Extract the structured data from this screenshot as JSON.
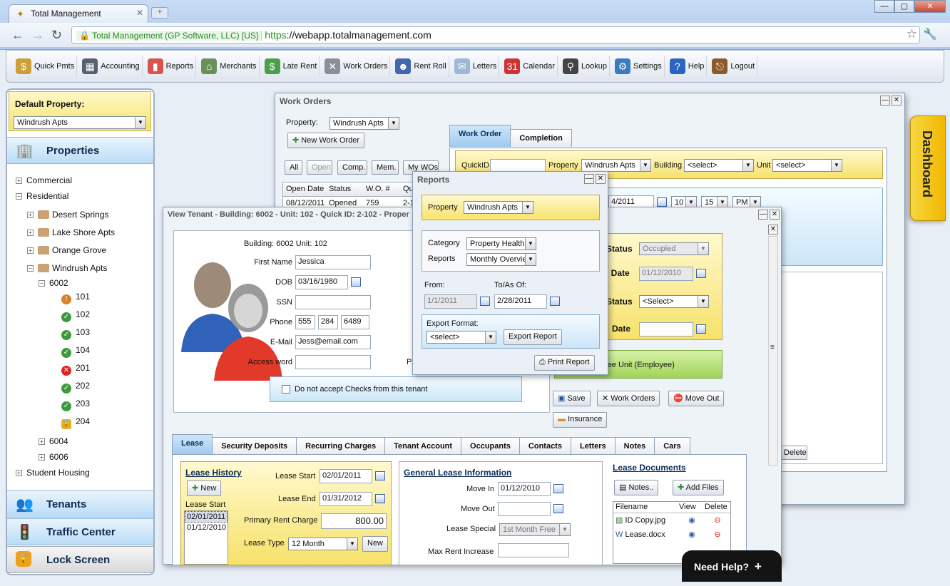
{
  "browser": {
    "tab_title": "Total Management",
    "tab_close": "✕",
    "new_tab": "+",
    "window_buttons": [
      "—",
      "▢",
      "✕"
    ],
    "nav_back": "←",
    "nav_forward": "→",
    "nav_reload": "↻",
    "cert_label": "Total Management (GP Software, LLC) [US]",
    "url_scheme": "https",
    "url_rest": "://webapp.totalmanagement.com",
    "star": "☆",
    "wrench": "🔧"
  },
  "toolbar": [
    {
      "label": "Quick Pmts",
      "icon": "quick-payments-icon",
      "color": "#c9a03a",
      "glyph": "$"
    },
    {
      "label": "Accounting",
      "icon": "accounting-icon",
      "color": "#556070",
      "glyph": "▦"
    },
    {
      "label": "Reports",
      "icon": "reports-icon",
      "color": "#d9534f",
      "glyph": "▮"
    },
    {
      "label": "Merchants",
      "icon": "merchants-icon",
      "color": "#6a8f5a",
      "glyph": "⌂"
    },
    {
      "label": "Late Rent",
      "icon": "late-rent-icon",
      "color": "#4aa04a",
      "glyph": "$"
    },
    {
      "label": "Work Orders",
      "icon": "work-orders-icon",
      "color": "#8a8f98",
      "glyph": "✕"
    },
    {
      "label": "Rent Roll",
      "icon": "rent-roll-icon",
      "color": "#4466aa",
      "glyph": "☻"
    },
    {
      "label": "Letters",
      "icon": "letters-icon",
      "color": "#9cb8d6",
      "glyph": "✉"
    },
    {
      "label": "Calendar",
      "icon": "calendar-icon",
      "color": "#c33",
      "glyph": "31"
    },
    {
      "label": "Lookup",
      "icon": "lookup-icon",
      "color": "#444",
      "glyph": "⚲"
    },
    {
      "label": "Settings",
      "icon": "settings-icon",
      "color": "#3a7bbf",
      "glyph": "⚙"
    },
    {
      "label": "Help",
      "icon": "help-icon",
      "color": "#2a65c2",
      "glyph": "?"
    },
    {
      "label": "Logout",
      "icon": "logout-icon",
      "color": "#8a5a2a",
      "glyph": "⎋"
    }
  ],
  "sidebar": {
    "default_property_label": "Default Property:",
    "default_property_value": "Windrush Apts",
    "properties_label": "Properties",
    "tree": {
      "commercial": "Commercial",
      "residential": "Residential",
      "desert_springs": "Desert Springs",
      "lake_shore": "Lake Shore Apts",
      "orange_grove": "Orange Grove",
      "windrush": "Windrush Apts",
      "b6002": "6002",
      "b6004": "6004",
      "b6006": "6006",
      "student_housing": "Student Housing"
    },
    "units": [
      {
        "label": "101",
        "status": "warn",
        "glyph": "!"
      },
      {
        "label": "102",
        "status": "ok",
        "glyph": "✓"
      },
      {
        "label": "103",
        "status": "ok",
        "glyph": "✓"
      },
      {
        "label": "104",
        "status": "ok",
        "glyph": "✓"
      },
      {
        "label": "201",
        "status": "vacant",
        "glyph": "✕"
      },
      {
        "label": "202",
        "status": "ok",
        "glyph": "✓"
      },
      {
        "label": "203",
        "status": "ok",
        "glyph": "✓"
      },
      {
        "label": "204",
        "status": "locked",
        "glyph": "🔒"
      }
    ],
    "plus": "+",
    "minus": "−",
    "tenants_label": "Tenants",
    "traffic_label": "Traffic Center",
    "lock_label": "Lock Screen"
  },
  "work_orders": {
    "title": "Work Orders",
    "property_label": "Property:",
    "property_value": "Windrush Apts",
    "new_button": "New Work Order",
    "filters": [
      "All",
      "Open",
      "Comp.",
      "Mem.",
      "My WOs"
    ],
    "columns": [
      "Open Date",
      "Status",
      "W.O. #",
      "Qui"
    ],
    "row": [
      "08/12/2011",
      "Opened",
      "759",
      "2-10"
    ],
    "tabs": [
      "Work Order",
      "Completion"
    ],
    "quickid_label": "QuickID",
    "prop_label": "Property",
    "prop_value": "Windrush Apts",
    "building_label": "Building",
    "building_value": "<select>",
    "unit_label": "Unit",
    "unit_value": "<select>",
    "date_value": "4/2011",
    "hour": "10",
    "minute": "15",
    "ampm": "PM",
    "delete_button": "Delete"
  },
  "reports_dialog": {
    "title": "Reports",
    "property_label": "Property",
    "property_value": "Windrush Apts",
    "category_label": "Category",
    "category_value": "Property Health",
    "reports_label": "Reports",
    "reports_value": "Monthly Overvie",
    "from_label": "From:",
    "from_value": "1/1/2011",
    "to_label": "To/As Of:",
    "to_value": "2/28/2011",
    "export_label": "Export Format:",
    "export_value": "<select>",
    "export_button": "Export Report",
    "print_button": "Print Report"
  },
  "view_tenant": {
    "title": "View Tenant - Building: 6002 - Unit: 102 - Quick ID: 2-102 - Proper",
    "building_unit": "Building: 6002  Unit: 102",
    "first_name_label": "First Name",
    "first_name": "Jessica",
    "dob_label": "DOB",
    "dob": "03/16/1980",
    "ssn_label": "SSN",
    "phone_label": "Phone",
    "phone": [
      "555",
      "284",
      "6489"
    ],
    "email_label": "E-Mail",
    "email": "Jess@email.com",
    "access_label": "Access word",
    "p_label": "P",
    "checks_label": "Do not accept Checks from this tenant",
    "status_label": "Status",
    "status_value": "Occupied",
    "date_label": "l Date",
    "date_value": "01/12/2010",
    "status2_label": "Status",
    "status2_value": "<Select>",
    "date2_label": "Date",
    "employee_label": "ree Unit (Employee)",
    "save_button": "Save",
    "work_orders_button": "Work Orders",
    "move_out_button": "Move Out",
    "insurance_button": "Insurance",
    "tabs": [
      "Lease",
      "Security Deposits",
      "Recurring Charges",
      "Tenant Account",
      "Occupants",
      "Contacts",
      "Letters",
      "Notes",
      "Cars"
    ],
    "lease_history_label": "Lease History",
    "new_button": "New",
    "lease_start_col": "Lease Start",
    "lease_list": [
      "02/01/2011",
      "01/12/2010"
    ],
    "lease_start_label": "Lease Start",
    "lease_start": "02/01/2011",
    "lease_end_label": "Lease End",
    "lease_end": "01/31/2012",
    "primary_rent_label": "Primary Rent Charge",
    "primary_rent": "800.00",
    "lease_type_label": "Lease Type",
    "lease_type": "12 Month",
    "lease_type_new": "New",
    "general_label": "General Lease Information",
    "move_in_label": "Move In",
    "move_in": "01/12/2010",
    "move_out_label": "Move Out",
    "lease_special_label": "Lease Special",
    "lease_special": "1st Month Free",
    "max_rent_label": "Max Rent Increase",
    "docs_label": "Lease Documents",
    "notes_button": "Notes..",
    "add_files_button": "Add Files",
    "docs_columns": [
      "Filename",
      "View",
      "Delete"
    ],
    "docs": [
      "ID Copy.jpg",
      "Lease.docx"
    ]
  },
  "dashboard_label": "Dashboard",
  "need_help": "Need Help?",
  "need_help_plus": "+"
}
